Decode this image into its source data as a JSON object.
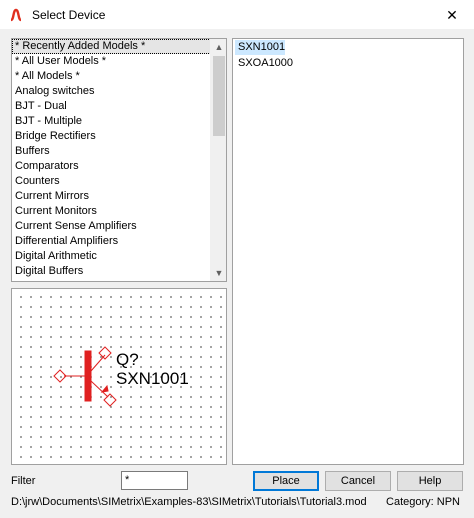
{
  "window": {
    "title": "Select Device",
    "close_glyph": "✕",
    "app_icon": "simetrix-app-icon"
  },
  "categories": {
    "items": [
      "* Recently Added Models *",
      "* All User Models *",
      "* All Models *",
      "Analog switches",
      "BJT - Dual",
      "BJT - Multiple",
      "Bridge Rectifiers",
      "Buffers",
      "Comparators",
      "Counters",
      "Current Mirrors",
      "Current Monitors",
      "Current Sense Amplifiers",
      "Differential Amplifiers",
      "Digital Arithmetic",
      "Digital Buffers"
    ],
    "selected_index": 0,
    "scroll_up_glyph": "▲",
    "scroll_down_glyph": "▼"
  },
  "models": {
    "items": [
      "SXN1001",
      "SXOA1000"
    ],
    "selected_index": 0
  },
  "preview": {
    "ref_label": "Q?",
    "model_label": "SXN1001",
    "symbol_color": "#e02020"
  },
  "filter": {
    "label": "Filter",
    "value": "*"
  },
  "buttons": {
    "place": "Place",
    "cancel": "Cancel",
    "help": "Help"
  },
  "status": {
    "path": "D:\\jrw\\Documents\\SIMetrix\\Examples-83\\SIMetrix\\Tutorials\\Tutorial3.mod",
    "category": "Category: NPN"
  }
}
